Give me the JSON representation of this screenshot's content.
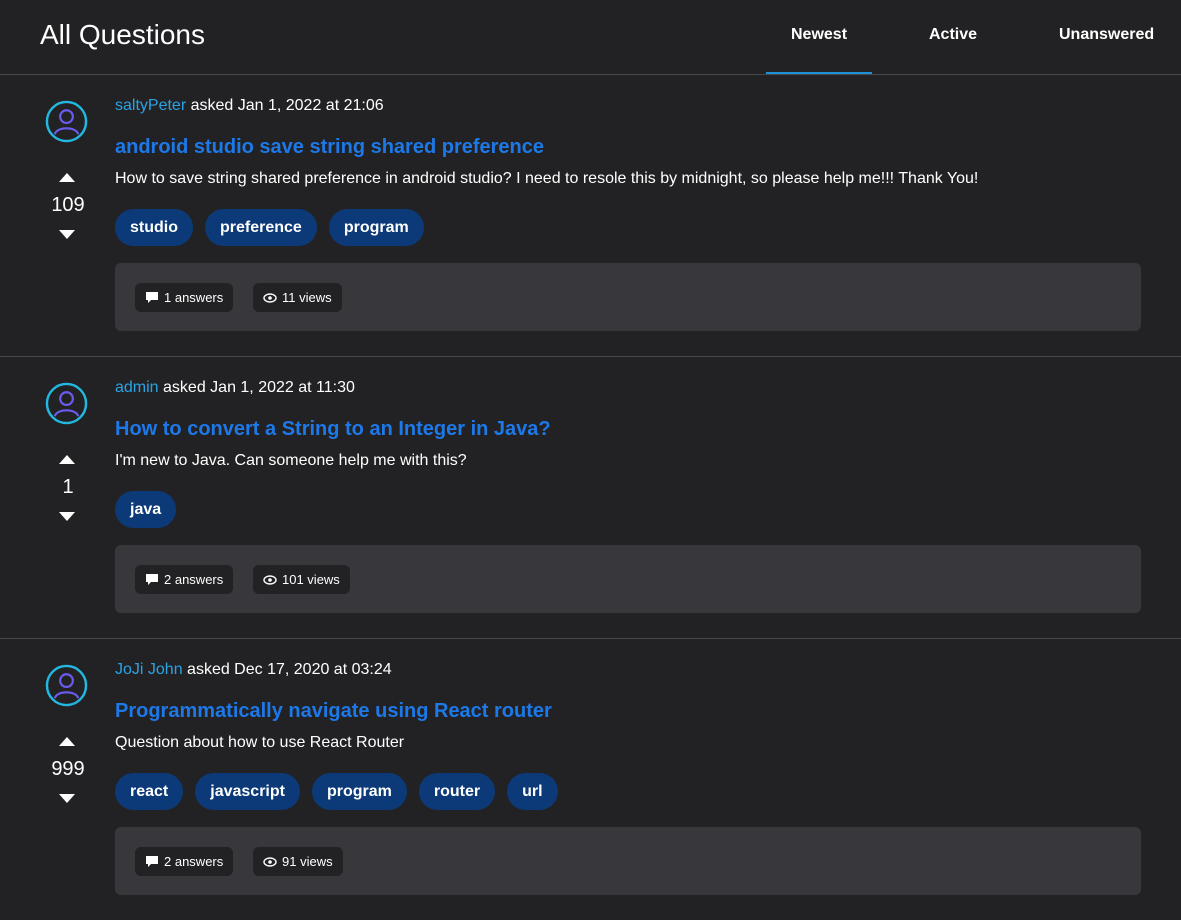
{
  "header": {
    "title": "All Questions",
    "tabs": [
      {
        "label": "Newest",
        "active": true
      },
      {
        "label": "Active",
        "active": false
      },
      {
        "label": "Unanswered",
        "active": false
      }
    ]
  },
  "colors": {
    "background": "#222224",
    "panel": "#38383c",
    "link_title": "#1d78e8",
    "author": "#2aa3e6",
    "tag_bg": "#0c3a78",
    "tab_underline": "#1f8fd6"
  },
  "questions": [
    {
      "author": "saltyPeter",
      "asked_text": " asked Jan 1, 2022 at 21:06",
      "votes": "109",
      "title": "android studio save string shared preference",
      "body": "How to save string shared preference in android studio? I need to resole this by midnight, so please help me!!! Thank You!",
      "tags": [
        "studio",
        "preference",
        "program"
      ],
      "answers": "1 answers",
      "views": "11 views"
    },
    {
      "author": "admin",
      "asked_text": " asked Jan 1, 2022 at 11:30",
      "votes": "1",
      "title": "How to convert a String to an Integer in Java?",
      "body": "I'm new to Java. Can someone help me with this?",
      "tags": [
        "java"
      ],
      "answers": "2 answers",
      "views": "101 views"
    },
    {
      "author": "JoJi John",
      "asked_text": " asked Dec 17, 2020 at 03:24",
      "votes": "999",
      "title": "Programmatically navigate using React router",
      "body": "Question about how to use React Router",
      "tags": [
        "react",
        "javascript",
        "program",
        "router",
        "url"
      ],
      "answers": "2 answers",
      "views": "91 views"
    }
  ]
}
